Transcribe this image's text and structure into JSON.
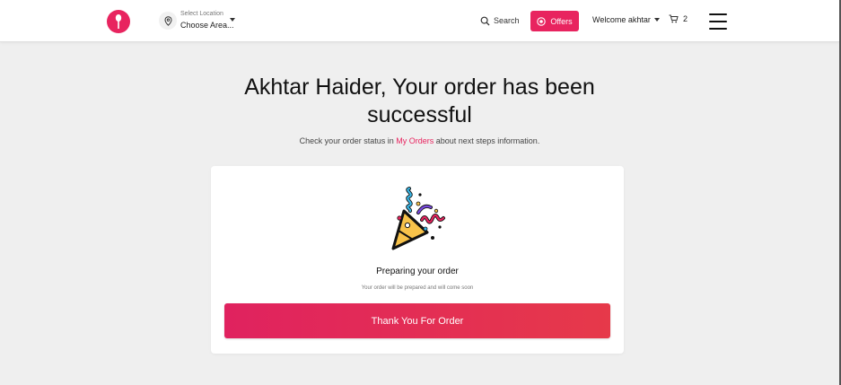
{
  "header": {
    "location_label": "Select Location",
    "location_value": "Choose Area...",
    "search_label": "Search",
    "offers_label": "Offers",
    "welcome_label": "Welcome akhtar",
    "cart_count": "2",
    "brand_color": "#e8245f"
  },
  "main": {
    "title_line1": "Akhtar Haider, Your order has been",
    "title_line2": "successful",
    "subtitle_prefix": "Check your order status in ",
    "subtitle_link": "My Orders",
    "subtitle_suffix": " about next steps information."
  },
  "card": {
    "illustration": "party-popper-icon",
    "heading": "Preparing your order",
    "subheading": "Your order will be prepared and will come soon",
    "button_label": "Thank You For Order"
  }
}
